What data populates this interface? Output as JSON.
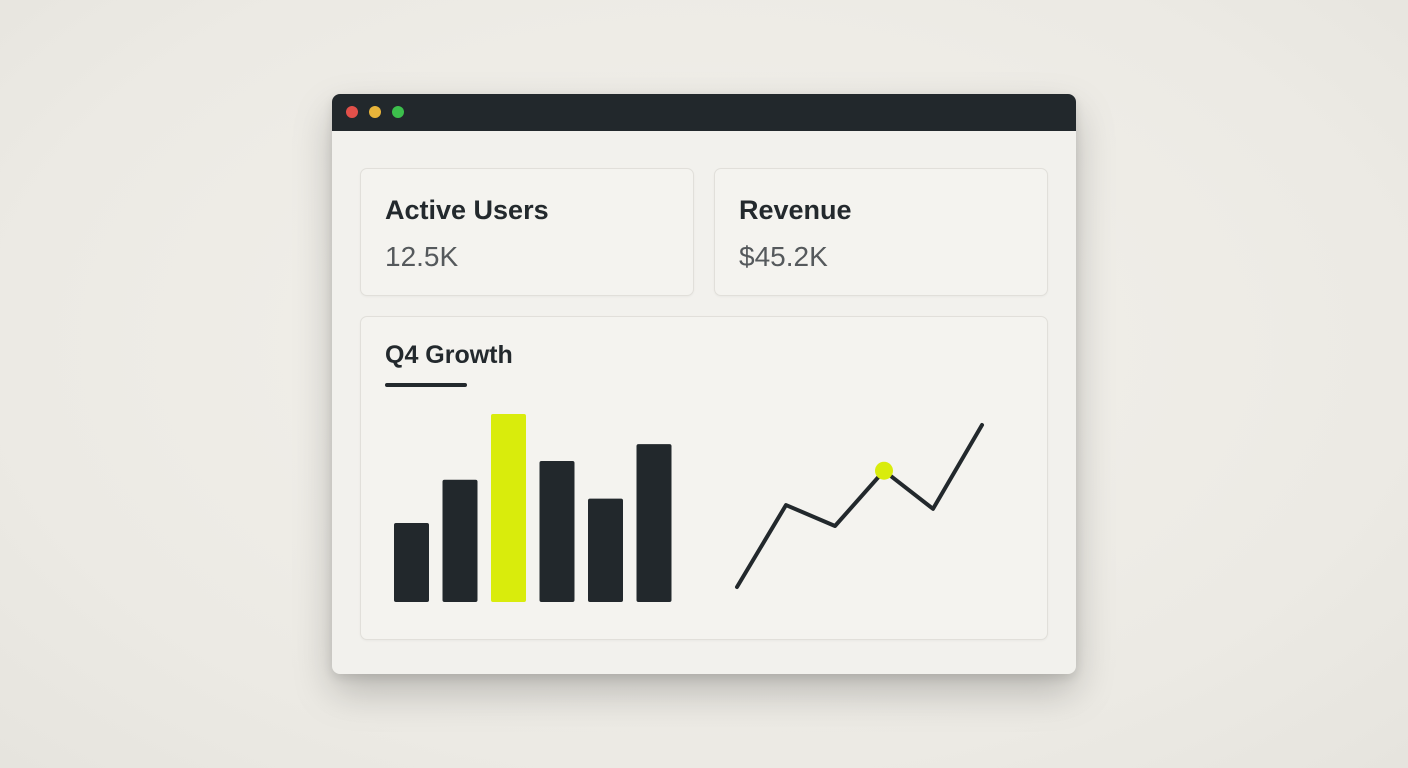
{
  "window": {
    "controls": [
      "close",
      "minimize",
      "maximize"
    ]
  },
  "metrics": {
    "active_users": {
      "label": "Active Users",
      "value": "12.5K"
    },
    "revenue": {
      "label": "Revenue",
      "value": "$45.2K"
    }
  },
  "growth": {
    "title": "Q4 Growth"
  },
  "colors": {
    "dark": "#22282c",
    "accent": "#d9ec0c",
    "card_bg": "#f4f3ef"
  },
  "chart_data": [
    {
      "type": "bar",
      "values": [
        42,
        65,
        100,
        75,
        55,
        84
      ],
      "highlight_index": 2,
      "ylim": [
        0,
        100
      ]
    },
    {
      "type": "line",
      "x": [
        0,
        1,
        2,
        3,
        4,
        5
      ],
      "values": [
        0,
        43,
        32,
        61,
        41,
        85
      ],
      "highlight_index": 3,
      "ylim": [
        0,
        85
      ]
    }
  ]
}
